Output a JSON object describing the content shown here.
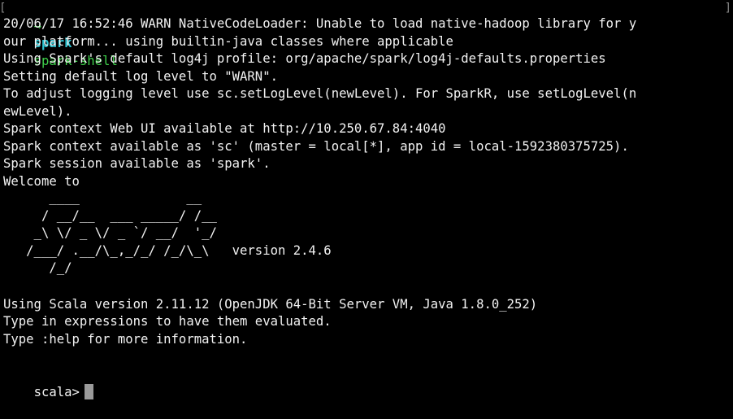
{
  "header": {
    "arrow": "→",
    "dir": "spark",
    "command": "spark-shell"
  },
  "output": {
    "lines": [
      "20/06/17 16:52:46 WARN NativeCodeLoader: Unable to load native-hadoop library for y",
      "our platform... using builtin-java classes where applicable",
      "Using Spark's default log4j profile: org/apache/spark/log4j-defaults.properties",
      "Setting default log level to \"WARN\".",
      "To adjust logging level use sc.setLogLevel(newLevel). For SparkR, use setLogLevel(n",
      "ewLevel).",
      "Spark context Web UI available at http://10.250.67.84:4040",
      "Spark context available as 'sc' (master = local[*], app id = local-1592380375725).",
      "Spark session available as 'spark'.",
      "Welcome to"
    ],
    "logo": "      ____              __\n     / __/__  ___ _____/ /__\n    _\\ \\/ _ \\/ _ `/ __/  '_/\n   /___/ .__/\\_,_/_/ /_/\\_\\   version 2.4.6\n      /_/",
    "footer_lines": [
      "Using Scala version 2.11.12 (OpenJDK 64-Bit Server VM, Java 1.8.0_252)",
      "Type in expressions to have them evaluated.",
      "Type :help for more information."
    ]
  },
  "prompt": {
    "label": "scala>"
  },
  "colors": {
    "background": "#000000",
    "text": "#f2f2f2",
    "green": "#3fd24b",
    "cyan": "#2ec5d3",
    "cursor": "#9a9a9a"
  }
}
